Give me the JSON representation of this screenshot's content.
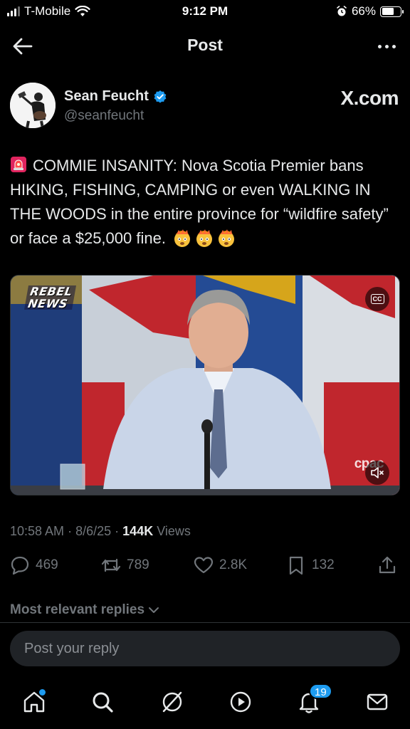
{
  "status_bar": {
    "carrier": "T-Mobile",
    "time": "9:12 PM",
    "battery": "66%",
    "battery_level": 0.66
  },
  "header": {
    "title": "Post"
  },
  "author": {
    "name": "Sean Feucht",
    "handle": "@seanfeucht",
    "watermark": "X.com"
  },
  "post": {
    "text": "COMMIE INSANITY: Nova Scotia Premier bans HIKING, FISHING, CAMPING or even WALKING IN THE WOODS in the entire province for “wildfire safety” or face a $25,000 fine.",
    "leading_emoji": "siren-emoji",
    "trailing_emojis": [
      "exploding-head-emoji",
      "exploding-head-emoji",
      "exploding-head-emoji"
    ]
  },
  "video": {
    "logo_line1": "REBEL",
    "logo_line2": "NEWS",
    "broadcaster": "cpac",
    "cc_label": "CC"
  },
  "meta": {
    "time": "10:58 AM",
    "separator": "·",
    "date": "8/6/25",
    "views_count": "144K",
    "views_label": "Views"
  },
  "actions": {
    "replies": "469",
    "reposts": "789",
    "likes": "2.8K",
    "bookmarks": "132"
  },
  "replies_sort": {
    "label": "Most relevant replies"
  },
  "reply_box": {
    "placeholder": "Post your reply"
  },
  "tab_bar": {
    "notifications_badge": "19"
  },
  "colors": {
    "accent": "#1d9bf0",
    "muted": "#71767b",
    "text": "#e7e9ea",
    "background": "#000000"
  }
}
